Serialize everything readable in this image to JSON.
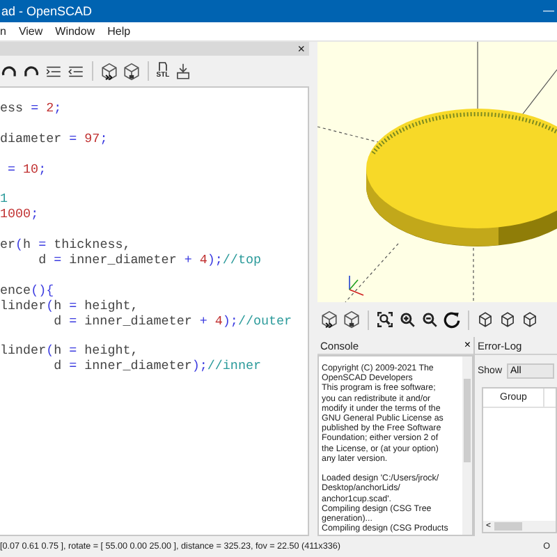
{
  "window": {
    "title": "ad - OpenSCAD",
    "minimize": "—"
  },
  "menu": [
    "n",
    "View",
    "Window",
    "Help"
  ],
  "editor": {
    "close": "×",
    "toolbar": [
      {
        "kind": "undo"
      },
      {
        "kind": "redo"
      },
      {
        "kind": "indent"
      },
      {
        "kind": "unindent"
      },
      {
        "kind": "sep"
      },
      {
        "kind": "preview"
      },
      {
        "kind": "render"
      },
      {
        "kind": "sep"
      },
      {
        "kind": "stl",
        "label": "STL"
      },
      {
        "kind": "print"
      }
    ],
    "lines": [
      {
        "gap_before": false,
        "tokens": [
          {
            "text": "ess ",
            "kind": "plain"
          },
          {
            "text": "= ",
            "kind": "operator"
          },
          {
            "text": "2",
            "kind": "number"
          },
          {
            "text": ";",
            "kind": "operator"
          }
        ]
      },
      {
        "gap_before": true,
        "tokens": [
          {
            "text": "diameter ",
            "kind": "plain"
          },
          {
            "text": "= ",
            "kind": "operator"
          },
          {
            "text": "97",
            "kind": "number"
          },
          {
            "text": ";",
            "kind": "operator"
          }
        ]
      },
      {
        "gap_before": true,
        "tokens": [
          {
            "text": " = ",
            "kind": "operator"
          },
          {
            "text": "10",
            "kind": "number"
          },
          {
            "text": ";",
            "kind": "operator"
          }
        ]
      },
      {
        "gap_before": true,
        "tokens": [
          {
            "text": "1",
            "kind": "comment"
          }
        ]
      },
      {
        "gap_before": false,
        "tokens": [
          {
            "text": "1000",
            "kind": "number"
          },
          {
            "text": ";",
            "kind": "operator"
          }
        ]
      },
      {
        "gap_before": true,
        "tokens": [
          {
            "text": "er",
            "kind": "plain"
          },
          {
            "text": "(",
            "kind": "operator"
          },
          {
            "text": "h ",
            "kind": "plain"
          },
          {
            "text": "= ",
            "kind": "operator"
          },
          {
            "text": "thickness,",
            "kind": "plain"
          }
        ]
      },
      {
        "gap_before": false,
        "tokens": [
          {
            "text": "     d ",
            "kind": "plain"
          },
          {
            "text": "= ",
            "kind": "operator"
          },
          {
            "text": "inner_diameter ",
            "kind": "plain"
          },
          {
            "text": "+ ",
            "kind": "operator"
          },
          {
            "text": "4",
            "kind": "number"
          },
          {
            "text": ");",
            "kind": "operator"
          },
          {
            "text": "//top",
            "kind": "comment"
          }
        ]
      },
      {
        "gap_before": true,
        "tokens": [
          {
            "text": "ence",
            "kind": "plain"
          },
          {
            "text": "(){",
            "kind": "operator"
          }
        ]
      },
      {
        "gap_before": false,
        "tokens": [
          {
            "text": "linder",
            "kind": "plain"
          },
          {
            "text": "(",
            "kind": "operator"
          },
          {
            "text": "h ",
            "kind": "plain"
          },
          {
            "text": "= ",
            "kind": "operator"
          },
          {
            "text": "height,",
            "kind": "plain"
          }
        ]
      },
      {
        "gap_before": false,
        "tokens": [
          {
            "text": "       d ",
            "kind": "plain"
          },
          {
            "text": "= ",
            "kind": "operator"
          },
          {
            "text": "inner_diameter ",
            "kind": "plain"
          },
          {
            "text": "+ ",
            "kind": "operator"
          },
          {
            "text": "4",
            "kind": "number"
          },
          {
            "text": ");",
            "kind": "operator"
          },
          {
            "text": "//outer",
            "kind": "comment"
          }
        ]
      },
      {
        "gap_before": true,
        "tokens": [
          {
            "text": "linder",
            "kind": "plain"
          },
          {
            "text": "(",
            "kind": "operator"
          },
          {
            "text": "h ",
            "kind": "plain"
          },
          {
            "text": "= ",
            "kind": "operator"
          },
          {
            "text": "height,",
            "kind": "plain"
          }
        ]
      },
      {
        "gap_before": false,
        "tokens": [
          {
            "text": "       d ",
            "kind": "plain"
          },
          {
            "text": "= ",
            "kind": "operator"
          },
          {
            "text": "inner_diameter",
            "kind": "plain"
          },
          {
            "text": ");",
            "kind": "operator"
          },
          {
            "text": "//inner",
            "kind": "comment"
          }
        ]
      }
    ]
  },
  "view_toolbar": [
    {
      "kind": "preview"
    },
    {
      "kind": "render"
    },
    {
      "kind": "sep"
    },
    {
      "kind": "zoom-all"
    },
    {
      "kind": "zoom-in"
    },
    {
      "kind": "zoom-out"
    },
    {
      "kind": "reset"
    },
    {
      "kind": "sep"
    },
    {
      "kind": "view"
    },
    {
      "kind": "view"
    },
    {
      "kind": "view"
    }
  ],
  "console": {
    "title": "Console",
    "close": "×",
    "lines": [
      {
        "text": "Copyright (C) 2009-2021 The",
        "gap_before": false
      },
      {
        "text": "OpenSCAD Developers",
        "gap_before": false
      },
      {
        "text": "This program is free software;",
        "gap_before": false
      },
      {
        "text": "you can redistribute it and/or",
        "gap_before": false
      },
      {
        "text": "modify it under the terms of the",
        "gap_before": false
      },
      {
        "text": "GNU General Public License as",
        "gap_before": false
      },
      {
        "text": "published by the Free Software",
        "gap_before": false
      },
      {
        "text": "Foundation; either version 2 of",
        "gap_before": false
      },
      {
        "text": "the License, or (at your option)",
        "gap_before": false
      },
      {
        "text": "any later version.",
        "gap_before": false
      },
      {
        "text": "Loaded design 'C:/Users/jrock/",
        "gap_before": true
      },
      {
        "text": "Desktop/anchorLids/",
        "gap_before": false
      },
      {
        "text": "anchor1cup.scad'.",
        "gap_before": false
      },
      {
        "text": "Compiling design (CSG Tree",
        "gap_before": false
      },
      {
        "text": "generation)...",
        "gap_before": false
      },
      {
        "text": "Compiling design (CSG Products",
        "gap_before": false
      }
    ]
  },
  "error_log": {
    "title": "Error-Log",
    "show_label": "Show",
    "show_value": "All",
    "columns": [
      "Group"
    ],
    "scroll_left": "<"
  },
  "status_bar": {
    "text": "[0.07 0.61 0.75 ], rotate = [ 55.00 0.00 25.00 ], distance = 325.23, fov = 22.50 (411x336)",
    "right": "O"
  }
}
